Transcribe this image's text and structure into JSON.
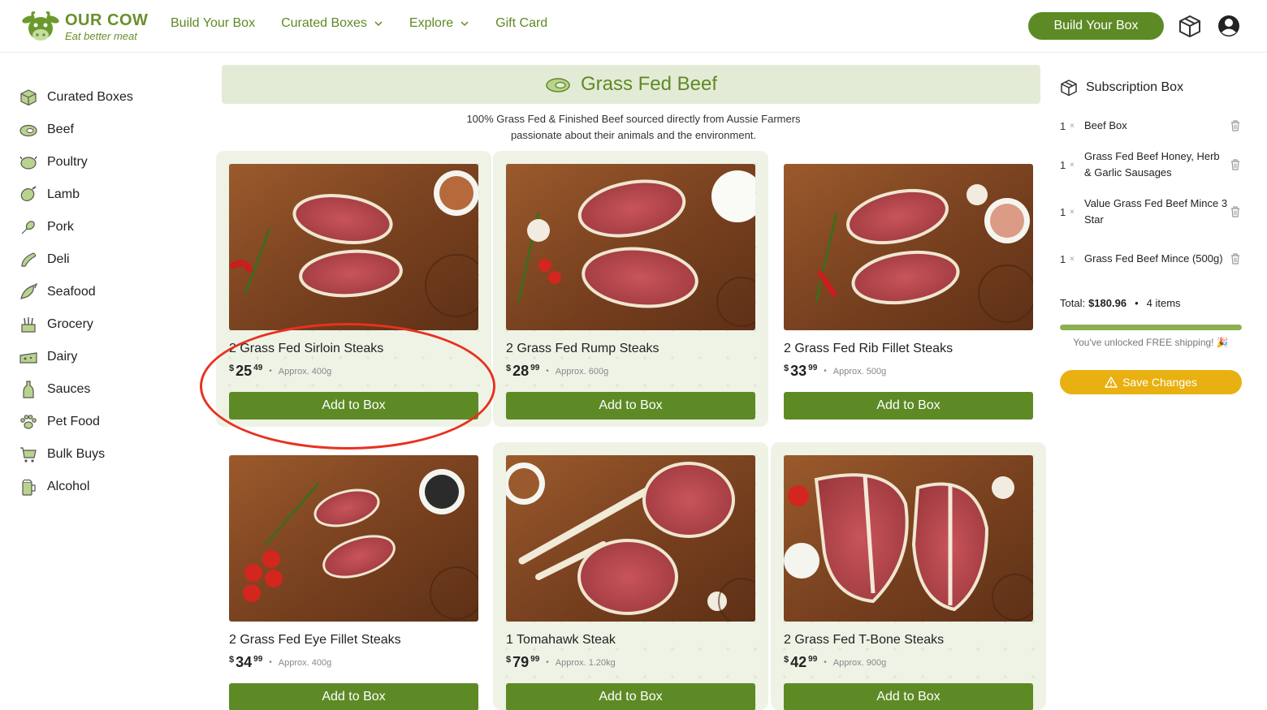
{
  "brand": {
    "name": "OUR COW",
    "tagline": "Eat better meat"
  },
  "nav": {
    "items": [
      {
        "label": "Build Your Box",
        "dropdown": false
      },
      {
        "label": "Curated Boxes",
        "dropdown": true
      },
      {
        "label": "Explore",
        "dropdown": true
      },
      {
        "label": "Gift Card",
        "dropdown": false
      }
    ],
    "cta_label": "Build Your Box"
  },
  "sidebar": {
    "items": [
      {
        "label": "Curated Boxes",
        "icon": "box-icon"
      },
      {
        "label": "Beef",
        "icon": "steak-icon"
      },
      {
        "label": "Poultry",
        "icon": "chicken-icon"
      },
      {
        "label": "Lamb",
        "icon": "lamb-icon"
      },
      {
        "label": "Pork",
        "icon": "pork-icon"
      },
      {
        "label": "Deli",
        "icon": "deli-icon"
      },
      {
        "label": "Seafood",
        "icon": "fish-icon"
      },
      {
        "label": "Grocery",
        "icon": "grocery-icon"
      },
      {
        "label": "Dairy",
        "icon": "cheese-icon"
      },
      {
        "label": "Sauces",
        "icon": "bottle-icon"
      },
      {
        "label": "Pet Food",
        "icon": "paw-icon"
      },
      {
        "label": "Bulk Buys",
        "icon": "cart-icon"
      },
      {
        "label": "Alcohol",
        "icon": "beer-icon"
      }
    ]
  },
  "category": {
    "title": "Grass Fed Beef",
    "description_line1": "100% Grass Fed & Finished Beef sourced directly from Aussie Farmers",
    "description_line2": "passionate about their animals and the environment."
  },
  "products": [
    {
      "name": "2 Grass Fed Sirloin Steaks",
      "currency": "$",
      "dollars": "25",
      "cents": "49",
      "approx": "Approx. 400g",
      "button": "Add to Box"
    },
    {
      "name": "2 Grass Fed Rump Steaks",
      "currency": "$",
      "dollars": "28",
      "cents": "99",
      "approx": "Approx. 600g",
      "button": "Add to Box"
    },
    {
      "name": "2 Grass Fed Rib Fillet Steaks",
      "currency": "$",
      "dollars": "33",
      "cents": "99",
      "approx": "Approx. 500g",
      "button": "Add to Box"
    },
    {
      "name": "2 Grass Fed Eye Fillet Steaks",
      "currency": "$",
      "dollars": "34",
      "cents": "99",
      "approx": "Approx. 400g",
      "button": "Add to Box"
    },
    {
      "name": "1 Tomahawk Steak",
      "currency": "$",
      "dollars": "79",
      "cents": "99",
      "approx": "Approx. 1.20kg",
      "button": "Add to Box"
    },
    {
      "name": "2 Grass Fed T-Bone Steaks",
      "currency": "$",
      "dollars": "42",
      "cents": "99",
      "approx": "Approx. 900g",
      "button": "Add to Box"
    }
  ],
  "subscription": {
    "title": "Subscription Box",
    "items": [
      {
        "qty": "1",
        "x": "×",
        "name": "Beef Box"
      },
      {
        "qty": "1",
        "x": "×",
        "name": "Grass Fed Beef Honey, Herb & Garlic Sausages"
      },
      {
        "qty": "1",
        "x": "×",
        "name": "Value Grass Fed Beef Mince 3 Star"
      },
      {
        "qty": "1",
        "x": "×",
        "name": "Grass Fed Beef Mince (500g)"
      }
    ],
    "total_label": "Total:",
    "total_value": "$180.96",
    "dot": "•",
    "item_count": "4 items",
    "shipping_progress": 1.0,
    "shipping_message": "You've unlocked FREE shipping! 🎉",
    "save_label": "Save Changes"
  },
  "colors": {
    "brand_green": "#5d8a25",
    "banner_bg": "#e3ebd7",
    "save_yellow": "#e8b111",
    "annotation_red": "#e8311f"
  }
}
